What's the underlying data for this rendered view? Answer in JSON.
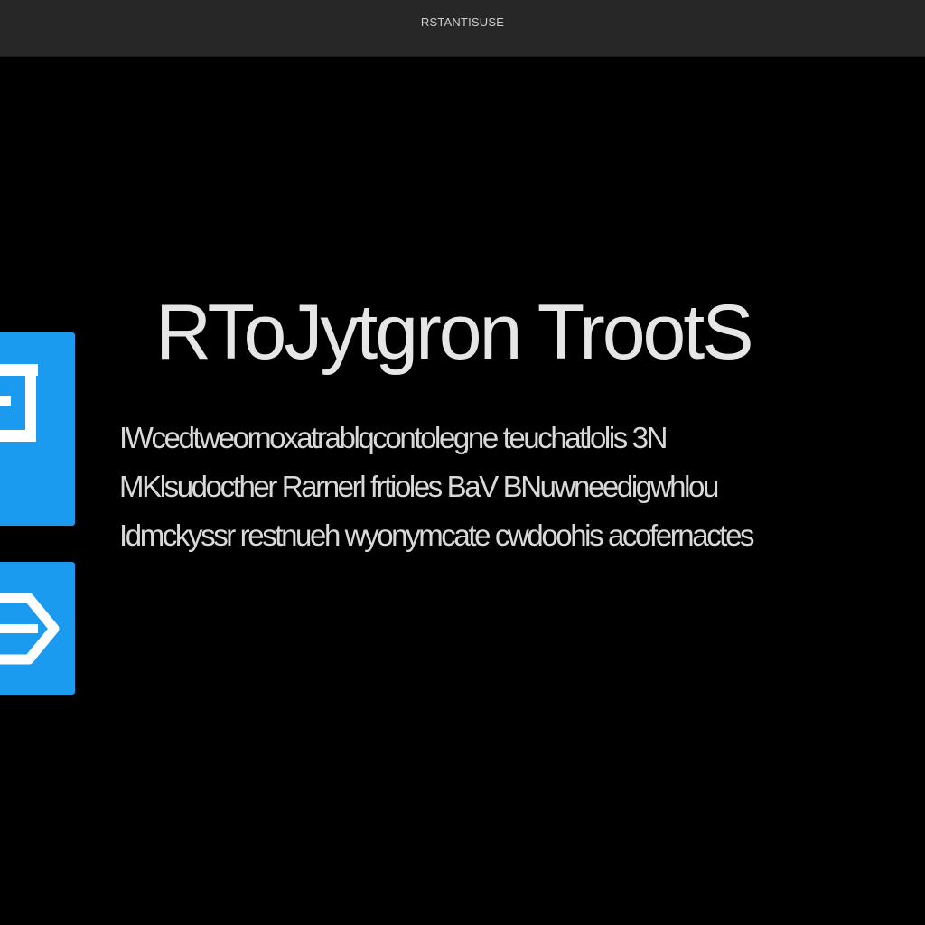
{
  "window": {
    "title": "RSTANTISUSE"
  },
  "main": {
    "headline": "RToJytgron TrootS",
    "description_lines": [
      "IWcedtweornoxatrablqcontolegne teuchatlolis 3N",
      "MKlsudocther Rarnerl frtioles BaV BNuwneedigwhlou",
      "Idmckyssr restnueh wyonymcate cwdoohis acofernactes"
    ]
  },
  "tiles": [
    {
      "icon": "document-icon",
      "color": "#1a9bef"
    },
    {
      "icon": "arrow-right-icon",
      "color": "#1a9bef"
    }
  ]
}
